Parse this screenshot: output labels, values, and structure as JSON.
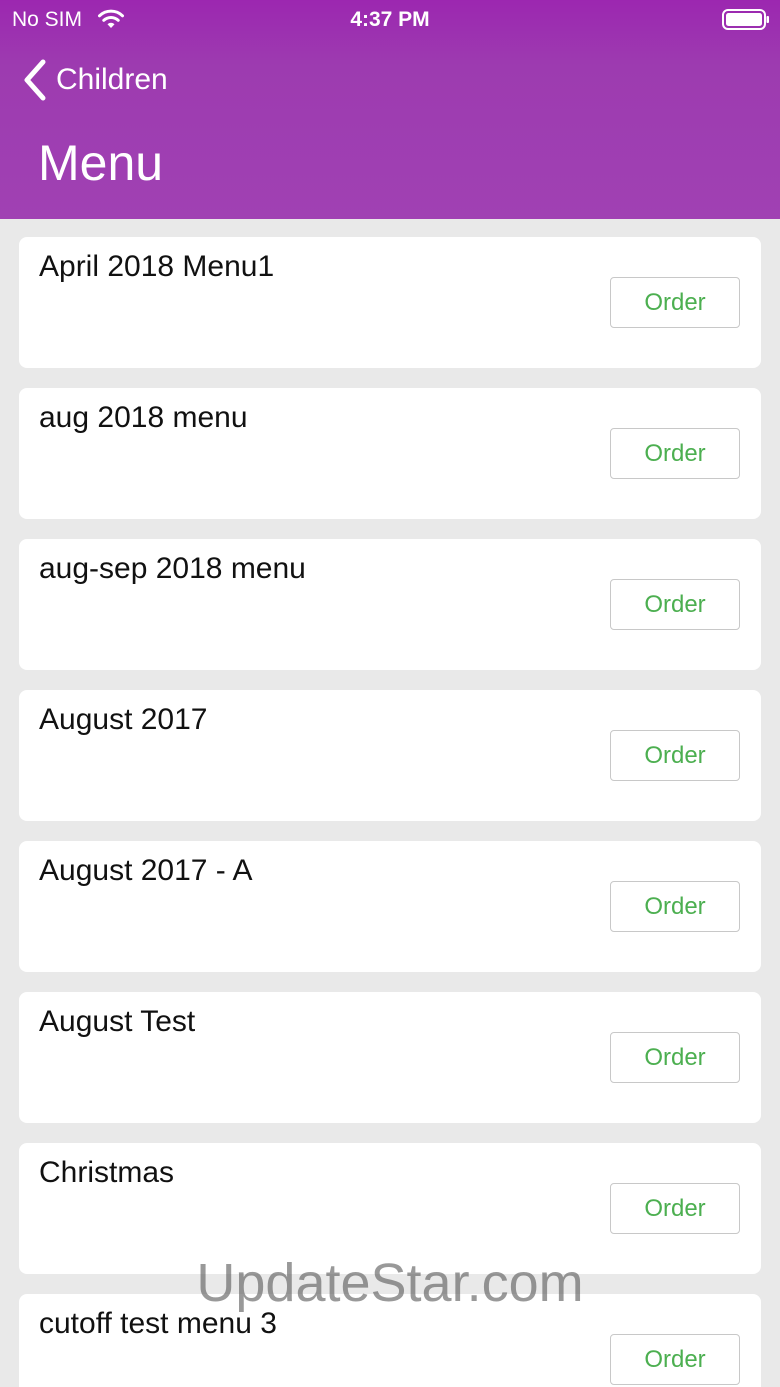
{
  "status_bar": {
    "carrier": "No SIM",
    "time": "4:37 PM",
    "wifi_icon": "wifi-icon",
    "battery_icon": "battery-icon"
  },
  "nav": {
    "back_label": "Children",
    "back_icon": "chevron-left-icon",
    "title": "Menu"
  },
  "colors": {
    "header_purple": "#9c27b0",
    "order_green": "#4caf50",
    "background": "#e9e9e9"
  },
  "menus": [
    {
      "title": "April 2018 Menu1",
      "action": "Order"
    },
    {
      "title": "aug 2018 menu",
      "action": "Order"
    },
    {
      "title": "aug-sep 2018 menu",
      "action": "Order"
    },
    {
      "title": "August 2017",
      "action": "Order"
    },
    {
      "title": "August 2017 - A",
      "action": "Order"
    },
    {
      "title": "August Test",
      "action": "Order"
    },
    {
      "title": "Christmas",
      "action": "Order"
    },
    {
      "title": "cutoff test menu 3",
      "action": "Order"
    }
  ],
  "watermark": "UpdateStar.com"
}
